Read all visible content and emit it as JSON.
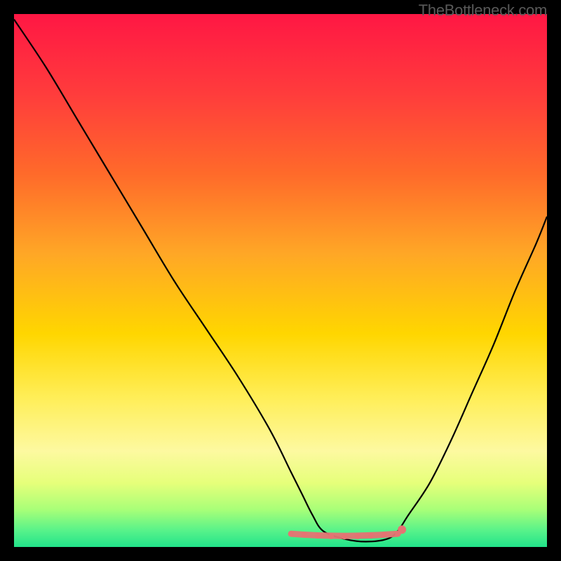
{
  "watermark": "TheBottleneck.com",
  "chart_data": {
    "type": "line",
    "title": "",
    "xlabel": "",
    "ylabel": "",
    "xlim": [
      0,
      100
    ],
    "ylim": [
      0,
      100
    ],
    "background_gradient_stops": [
      {
        "offset": 0.0,
        "color": "#ff1744"
      },
      {
        "offset": 0.15,
        "color": "#ff3c3c"
      },
      {
        "offset": 0.3,
        "color": "#ff6a2a"
      },
      {
        "offset": 0.45,
        "color": "#ffa726"
      },
      {
        "offset": 0.6,
        "color": "#ffd600"
      },
      {
        "offset": 0.72,
        "color": "#ffee58"
      },
      {
        "offset": 0.82,
        "color": "#fdf9a0"
      },
      {
        "offset": 0.88,
        "color": "#e6ff7a"
      },
      {
        "offset": 0.93,
        "color": "#a8ff78"
      },
      {
        "offset": 0.97,
        "color": "#56f28a"
      },
      {
        "offset": 1.0,
        "color": "#22e38a"
      }
    ],
    "series": [
      {
        "name": "bottleneck-curve",
        "color": "#000000",
        "x": [
          0,
          6,
          12,
          18,
          24,
          30,
          36,
          42,
          48,
          52,
          54,
          56,
          58,
          62,
          66,
          70,
          72,
          74,
          78,
          82,
          86,
          90,
          94,
          98,
          100
        ],
        "y": [
          99,
          90,
          80,
          70,
          60,
          50,
          41,
          32,
          22,
          14,
          10,
          6,
          3,
          1.5,
          1,
          1.5,
          3,
          6,
          12,
          20,
          29,
          38,
          48,
          57,
          62
        ]
      }
    ],
    "flat_zone": {
      "color": "#e57373",
      "x_start": 52,
      "x_end": 72,
      "y": 3,
      "dot_radius": 4
    }
  }
}
